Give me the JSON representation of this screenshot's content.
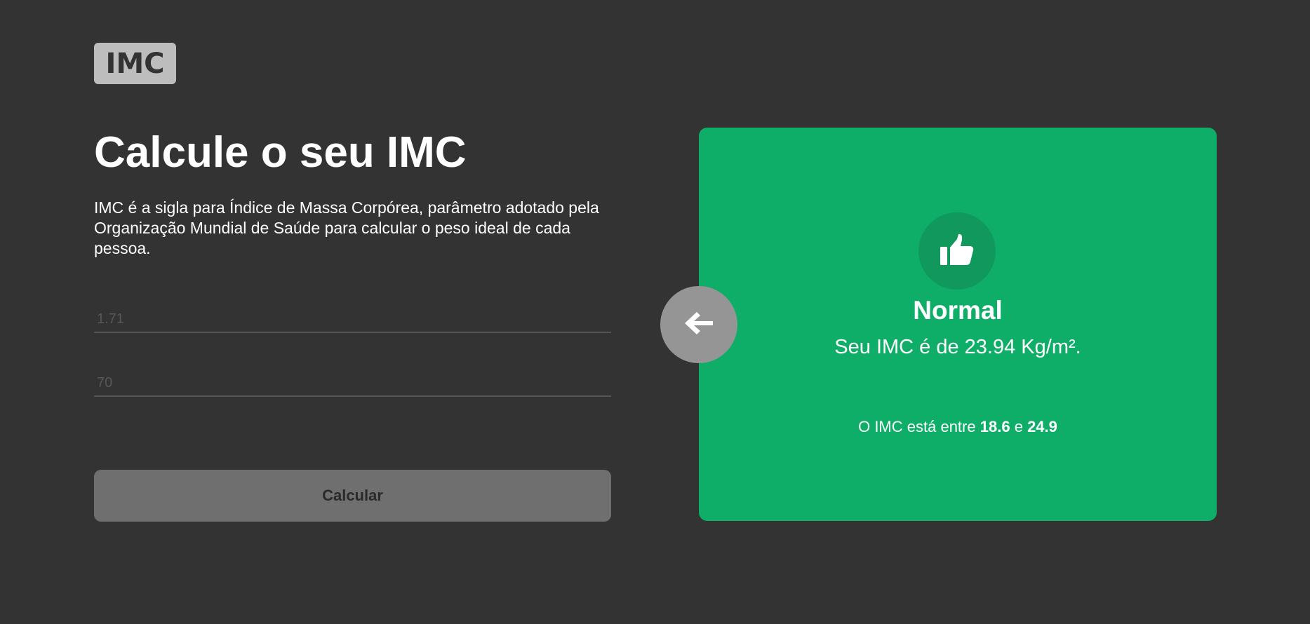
{
  "logo": {
    "text": "IMC"
  },
  "main": {
    "title": "Calcule o seu IMC",
    "description": "IMC é a sigla para Índice de Massa Corpórea, parâmetro adotado pela Organização Mundial de Saúde para calcular o peso ideal de cada pessoa.",
    "height_input": {
      "placeholder": "1.71",
      "value": ""
    },
    "weight_input": {
      "placeholder": "70",
      "value": ""
    },
    "calculate_label": "Calcular"
  },
  "result": {
    "status": "Normal",
    "value_text": "Seu IMC é de 23.94 Kg/m².",
    "range_prefix": "O IMC está entre",
    "range_min": "18.6",
    "range_joiner": "e",
    "range_max": "24.9",
    "icon": "thumbs-up-icon",
    "background_color": "#0fae68"
  },
  "back_button": {
    "icon": "arrow-left-icon"
  }
}
